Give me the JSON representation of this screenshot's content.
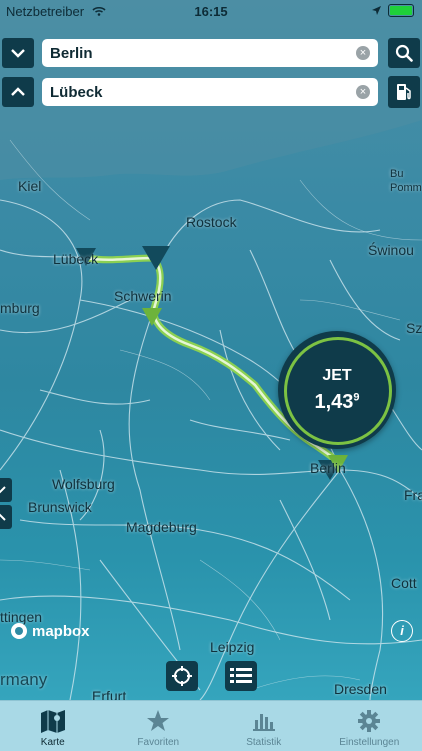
{
  "status": {
    "carrier": "Netzbetreiber",
    "time": "16:15"
  },
  "search": {
    "from": "Berlin",
    "to": "Lübeck"
  },
  "map": {
    "labels": {
      "kiel": "Kiel",
      "rostock": "Rostock",
      "lubeck": "Lübeck",
      "schwerin": "Schwerin",
      "hamburg": "mburg",
      "swinou": "Świnou",
      "pomm": "Pomm",
      "bu": "Bu",
      "sz": "Sz",
      "wolfsburg": "Wolfsburg",
      "brunswick": "Brunswick",
      "magdeburg": "Magdeburg",
      "cott": "Cott",
      "fra": "Fra",
      "berlin": "Berlin",
      "leipzig": "Leipzig",
      "dresden": "Dresden",
      "erfurt": "Erfurt",
      "ttingen": "ttingen",
      "rmany": "rmany"
    },
    "attribution": "mapbox"
  },
  "price_bubble": {
    "fuel": "JET",
    "price_main": "1,43",
    "price_sup": "9"
  },
  "tabs": [
    {
      "label": "Karte",
      "icon": "map-icon"
    },
    {
      "label": "Favoriten",
      "icon": "star-icon"
    },
    {
      "label": "Statistik",
      "icon": "bar-chart-icon"
    },
    {
      "label": "Einstellungen",
      "icon": "gear-icon"
    }
  ],
  "colors": {
    "accent": "#7cc243",
    "dark": "#0f3b4a",
    "tabbar": "#a9d9e6"
  }
}
